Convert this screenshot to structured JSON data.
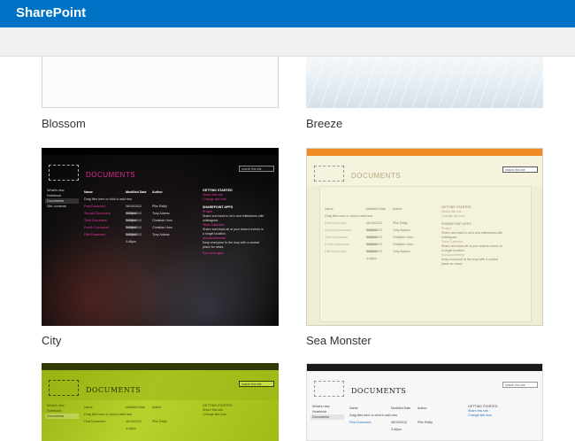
{
  "suite_bar": {
    "brand": "SharePoint"
  },
  "themes": [
    {
      "name": "Blossom"
    },
    {
      "name": "Breeze"
    },
    {
      "name": "City"
    },
    {
      "name": "Sea Monster"
    }
  ],
  "preview": {
    "site_title": "DOCUMENTS",
    "search_placeholder": "search this site",
    "nav": [
      "What's new",
      "Notebook",
      "Documents",
      "Site contents"
    ],
    "columns": [
      "Name",
      "Modified Date",
      "Author"
    ],
    "drag_hint": "Drag files here or click to add new",
    "docs": [
      [
        "First Document",
        "06/15/2012 3:48pm",
        "Pike Reilly"
      ],
      [
        "Second Document",
        "06/15/2012 3:48pm",
        "Tony Adams"
      ],
      [
        "Third Document",
        "06/15/2012 3:48pm",
        "Christian Haro"
      ],
      [
        "Fourth Document",
        "06/15/2012 3:48pm",
        "Christian Haro"
      ],
      [
        "Fifth Document",
        "06/15/2012 3:48pm",
        "Tony Adams"
      ]
    ],
    "getting_started": "GETTING STARTED",
    "share_site": "Share this site",
    "change_look": "Change site look",
    "sharepoint_apps": "SHAREPOINT APPS",
    "project": "Project",
    "apps_text": "Share and track to do's and milestones with colleagues.",
    "team_calendar": "Team Calendar",
    "cal_text": "Share and track all of your team's events in a single location.",
    "announcements": "Announcements",
    "ann_text": "Keep everyone in the loop with a central place for news.",
    "get_more": "Get more apps"
  }
}
